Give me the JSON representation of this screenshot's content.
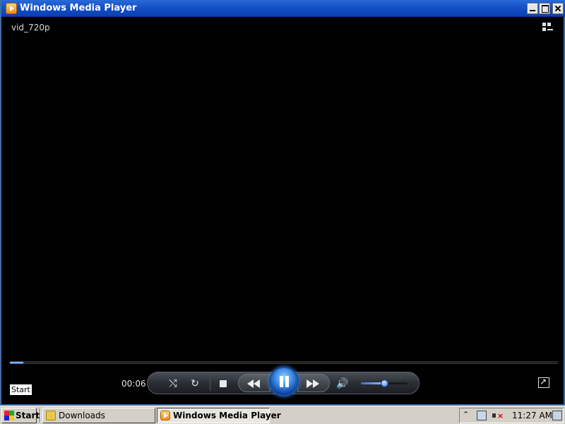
{
  "window": {
    "title": "Windows Media Player"
  },
  "player": {
    "video_title": "vid_720p",
    "elapsed_time": "00:06",
    "seek_progress": 0.025,
    "volume_level": 0.5,
    "state": "playing",
    "start_label": "Start"
  },
  "taskbar": {
    "start_label": "Start",
    "tasks": [
      {
        "label": "Downloads",
        "icon": "folder-icon",
        "active": false
      },
      {
        "label": "Windows Media Player",
        "icon": "media-player-icon",
        "active": true
      }
    ],
    "clock": "11:27 AM"
  },
  "colors": {
    "titlebar": "#1450c8",
    "play_button": "#3b8be6",
    "taskbar": "#d4d0c8",
    "video_bg": "#000000"
  }
}
